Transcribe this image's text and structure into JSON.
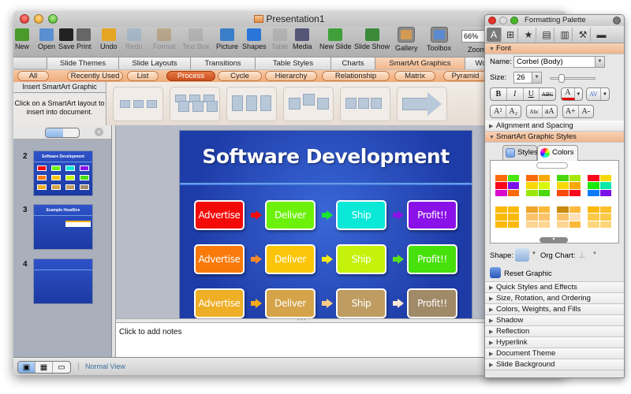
{
  "window": {
    "title": "Presentation1"
  },
  "toolbar": {
    "items": [
      {
        "label": "New",
        "icon": "new-document-icon",
        "enabled": true
      },
      {
        "label": "Open",
        "icon": "open-folder-icon",
        "enabled": true
      },
      {
        "label": "Save",
        "icon": "save-disk-icon",
        "enabled": true
      },
      {
        "label": "Print",
        "icon": "printer-icon",
        "enabled": true
      },
      {
        "label": "Undo",
        "icon": "undo-icon",
        "enabled": true
      },
      {
        "label": "Redo",
        "icon": "redo-icon",
        "enabled": false
      },
      {
        "label": "Format",
        "icon": "format-brush-icon",
        "enabled": false
      },
      {
        "label": "Text Box",
        "icon": "text-box-icon",
        "enabled": false
      },
      {
        "label": "Picture",
        "icon": "picture-icon",
        "enabled": true
      },
      {
        "label": "Shapes",
        "icon": "shapes-icon",
        "enabled": true
      },
      {
        "label": "Table",
        "icon": "table-icon",
        "enabled": false
      },
      {
        "label": "Media",
        "icon": "media-icon",
        "enabled": true
      },
      {
        "label": "New Slide",
        "icon": "new-slide-icon",
        "enabled": true
      },
      {
        "label": "Slide Show",
        "icon": "slide-show-icon",
        "enabled": true
      },
      {
        "label": "Gallery",
        "icon": "gallery-icon",
        "enabled": true
      },
      {
        "label": "Toolbox",
        "icon": "toolbox-icon",
        "enabled": true
      }
    ],
    "zoom_value": "66%",
    "zoom_label": "Zoom"
  },
  "ribbon_tabs": [
    {
      "label": "Slide Themes"
    },
    {
      "label": "Slide Layouts"
    },
    {
      "label": "Transitions"
    },
    {
      "label": "Table Styles"
    },
    {
      "label": "Charts"
    },
    {
      "label": "SmartArt Graphics",
      "selected": true
    },
    {
      "label": "Wo"
    }
  ],
  "smartart_categories": [
    {
      "label": "All"
    },
    {
      "label": "Recently Used"
    },
    {
      "label": "List"
    },
    {
      "label": "Process",
      "selected": true
    },
    {
      "label": "Cycle"
    },
    {
      "label": "Hierarchy"
    },
    {
      "label": "Relationship"
    },
    {
      "label": "Matrix"
    },
    {
      "label": "Pyramid"
    }
  ],
  "gallery": {
    "heading": "Insert SmartArt Graphic",
    "hint": "Click on a SmartArt layout to insert into document."
  },
  "slides": [
    {
      "number": "2",
      "title": "Software Development"
    },
    {
      "number": "3",
      "title": "Example Headline"
    },
    {
      "number": "4",
      "title": ""
    }
  ],
  "current_slide": {
    "title": "Software Development",
    "rows": [
      {
        "nodes": [
          {
            "label": "Advertise",
            "color": "#f50a0a"
          },
          {
            "label": "Deliver",
            "color": "#6cf20a"
          },
          {
            "label": "Ship",
            "color": "#0ae8d8"
          },
          {
            "label": "Profit!!",
            "color": "#8a12e8"
          }
        ],
        "arrows": [
          "#f50a0a",
          "#18e830",
          "#8a12e8"
        ]
      },
      {
        "nodes": [
          {
            "label": "Advertise",
            "color": "#f97a0a"
          },
          {
            "label": "Deliver",
            "color": "#fbc60a"
          },
          {
            "label": "Ship",
            "color": "#c4f20a"
          },
          {
            "label": "Profit!!",
            "color": "#46e00a"
          }
        ],
        "arrows": [
          "#f9882a",
          "#f6ea18",
          "#58e018"
        ]
      },
      {
        "nodes": [
          {
            "label": "Advertise",
            "color": "#eeae25"
          },
          {
            "label": "Deliver",
            "color": "#d5a44a"
          },
          {
            "label": "Ship",
            "color": "#bf9d62"
          },
          {
            "label": "Profit!!",
            "color": "#a18a68"
          }
        ],
        "arrows": [
          "#f4a81a",
          "#fbcb86",
          "#fbe8d6"
        ]
      }
    ]
  },
  "notes": {
    "placeholder": "Click to add notes"
  },
  "statusbar": {
    "view_label": "Normal View"
  },
  "palette": {
    "title": "Formatting Palette",
    "font_section": "Font",
    "name_label": "Name:",
    "name_value": "Corbel (Body)",
    "size_label": "Size:",
    "size_value": "26",
    "style_buttons": [
      "B",
      "I",
      "U",
      "ABC"
    ],
    "script_buttons": [
      "A²",
      "A₂",
      "Abc",
      "aA",
      "A+",
      "A-"
    ],
    "sections_closed_top": [
      "Alignment and Spacing"
    ],
    "smartart_section": "SmartArt Graphic Styles",
    "styles_tab": "Styles",
    "colors_tab": "Colors",
    "swatches": [
      [
        "#fa6a0a",
        "#4ae60a",
        "#f8081a",
        "#7a12e8",
        "#d80acb",
        "#fa6a0a"
      ],
      [
        "#fa6a0a",
        "#f8aa0a",
        "#f8d80a",
        "#d8f80a",
        "#9ae80a",
        "#4ad80a"
      ],
      [
        "#4ad80a",
        "#a8e80a",
        "#f8d80a",
        "#f8a80a",
        "#f84a0a",
        "#f80a1a"
      ],
      [
        "#f8081a",
        "#f8d80a",
        "#1ae80a",
        "#0ae8a8",
        "#0a7af8",
        "#7a12e8"
      ],
      [
        "#fbb90a",
        "#fbb90a",
        "#fbb90a",
        "#fbb90a",
        "#fbb90a",
        "#fbb90a"
      ],
      [
        "#eea52a",
        "#fbb93a",
        "#fbc46a",
        "#fbc46a",
        "#fdd592",
        "#fdd592"
      ],
      [
        "#c88a0a",
        "#fbb93a",
        "#fbc46a",
        "#fde0b8",
        "#fdd592",
        "#fbb93a"
      ],
      [
        "#fbb90a",
        "#fbc02a",
        "#fbca4a",
        "#fbca4a",
        "#fdd57a",
        "#fdd57a"
      ]
    ],
    "shape_label": "Shape:",
    "org_chart_label": "Org Chart:",
    "reset_label": "Reset Graphic",
    "sections_closed": [
      "Quick Styles and Effects",
      "Size, Rotation, and Ordering",
      "Colors, Weights, and Fills",
      "Shadow",
      "Reflection",
      "Hyperlink",
      "Document Theme",
      "Slide Background"
    ]
  }
}
